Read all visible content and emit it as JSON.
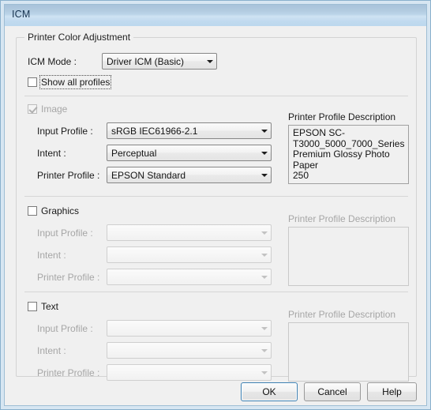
{
  "window": {
    "title": "ICM"
  },
  "groupbox": {
    "title": "Printer Color Adjustment"
  },
  "icm_mode": {
    "label": "ICM Mode :",
    "value": "Driver ICM (Basic)"
  },
  "show_all_profiles": {
    "label": "Show all profiles",
    "checked": false
  },
  "sections": [
    {
      "name": "image",
      "checkbox_label": "Image",
      "checked": true,
      "enabled": false,
      "fields": [
        {
          "label": "Input Profile :",
          "value": "sRGB IEC61966-2.1"
        },
        {
          "label": "Intent :",
          "value": "Perceptual"
        },
        {
          "label": "Printer Profile :",
          "value": "EPSON Standard"
        }
      ],
      "description_title": "Printer Profile Description",
      "description_text": "EPSON SC-T3000_5000_7000_Series Premium Glossy Photo Paper 250",
      "description_lines": [
        "EPSON SC-",
        "T3000_5000_7000_Series",
        "Premium Glossy Photo Paper",
        "250"
      ]
    },
    {
      "name": "graphics",
      "checkbox_label": "Graphics",
      "checked": false,
      "enabled": false,
      "fields": [
        {
          "label": "Input Profile :",
          "value": ""
        },
        {
          "label": "Intent :",
          "value": ""
        },
        {
          "label": "Printer Profile :",
          "value": ""
        }
      ],
      "description_title": "Printer Profile Description",
      "description_text": "",
      "description_lines": []
    },
    {
      "name": "text",
      "checkbox_label": "Text",
      "checked": false,
      "enabled": false,
      "fields": [
        {
          "label": "Input Profile :",
          "value": ""
        },
        {
          "label": "Intent :",
          "value": ""
        },
        {
          "label": "Printer Profile :",
          "value": ""
        }
      ],
      "description_title": "Printer Profile Description",
      "description_text": "",
      "description_lines": []
    }
  ],
  "buttons": {
    "ok": "OK",
    "cancel": "Cancel",
    "help": "Help"
  },
  "colors": {
    "titlebar_top": "#a8c2da",
    "titlebar_bottom": "#bcd8ee",
    "window_frame": "#d7e6f2",
    "client_bg": "#f0f0f0",
    "default_button_border": "#3c7fb1",
    "disabled_text": "#a6a6a6"
  }
}
